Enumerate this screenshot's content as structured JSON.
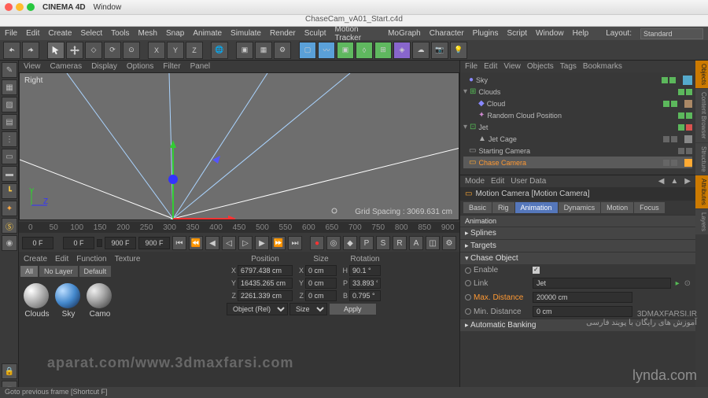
{
  "title": {
    "app": "CINEMA 4D",
    "menu": "Window",
    "doc": "ChaseCam_vA01_Start.c4d"
  },
  "menubar": [
    "File",
    "Edit",
    "Create",
    "Select",
    "Tools",
    "Mesh",
    "Snap",
    "Animate",
    "Simulate",
    "Render",
    "Sculpt",
    "Motion Tracker",
    "MoGraph",
    "Character",
    "Plugins",
    "Script",
    "Window",
    "Help"
  ],
  "layout_label": "Layout:",
  "layout_value": "Standard",
  "axis_letters": [
    "X",
    "Y",
    "Z"
  ],
  "viewmenu": [
    "View",
    "Cameras",
    "Display",
    "Options",
    "Filter",
    "Panel"
  ],
  "viewport": {
    "label": "Right",
    "grid_label": "Grid Spacing :",
    "grid_value": "3069.631 cm"
  },
  "timeline_marks": [
    "0",
    "50",
    "100",
    "150",
    "200",
    "250",
    "300",
    "350",
    "400",
    "450",
    "500",
    "550",
    "600",
    "650",
    "700",
    "750",
    "800",
    "850",
    "900"
  ],
  "transport": {
    "cur": "0 F",
    "start": "0 F",
    "end": "900 F",
    "end2": "900 F"
  },
  "materials": {
    "menu": [
      "Create",
      "Edit",
      "Function",
      "Texture"
    ],
    "tabs": [
      "All",
      "No Layer",
      "Default"
    ],
    "items": [
      "Clouds",
      "Sky",
      "Camo"
    ]
  },
  "coords": {
    "headers": [
      "Position",
      "Size",
      "Rotation"
    ],
    "rows": [
      {
        "axis": "X",
        "pos": "6797.438 cm",
        "size": "0 cm",
        "rot": "90.1 °",
        "rotlab": "H"
      },
      {
        "axis": "Y",
        "pos": "16435.265 cm",
        "size": "0 cm",
        "rot": "33.893 °",
        "rotlab": "P"
      },
      {
        "axis": "Z",
        "pos": "2261.339 cm",
        "size": "0 cm",
        "rot": "0.795 °",
        "rotlab": "B"
      }
    ],
    "obj_mode": "Object (Rel)",
    "size_mode": "Size",
    "apply": "Apply"
  },
  "obj": {
    "menu": [
      "File",
      "Edit",
      "View",
      "Objects",
      "Tags",
      "Bookmarks"
    ],
    "tree": [
      {
        "name": "Sky",
        "depth": 0,
        "cls": ""
      },
      {
        "name": "Clouds",
        "depth": 0,
        "cls": "",
        "exp": true
      },
      {
        "name": "Cloud",
        "depth": 1,
        "cls": ""
      },
      {
        "name": "Random Cloud Position",
        "depth": 1,
        "cls": ""
      },
      {
        "name": "Jet",
        "depth": 0,
        "cls": "",
        "exp": true
      },
      {
        "name": "Jet Cage",
        "depth": 1,
        "cls": ""
      },
      {
        "name": "Starting Camera",
        "depth": 0,
        "cls": ""
      },
      {
        "name": "Chase Camera",
        "depth": 0,
        "cls": "orange",
        "sel": true
      }
    ]
  },
  "attr": {
    "menu": [
      "Mode",
      "Edit",
      "User Data"
    ],
    "title": "Motion Camera [Motion Camera]",
    "tabs": [
      "Basic",
      "Rig",
      "Animation",
      "Dynamics",
      "Motion",
      "Focus"
    ],
    "active_tab": "Animation",
    "sections": {
      "anim": "Animation",
      "splines": "Splines",
      "targets": "Targets",
      "chase": "Chase Object",
      "auto": "Automatic Banking"
    },
    "chase": {
      "enable_label": "Enable",
      "enable": true,
      "link_label": "Link",
      "link": "Jet",
      "max_label": "Max. Distance",
      "max": "20000 cm",
      "min_label": "Min. Distance",
      "min": "0 cm"
    }
  },
  "right_tabs": [
    "Objects",
    "Content Browser",
    "Structure",
    "Attributes",
    "Layers"
  ],
  "status": "Goto previous frame [Shortcut F]",
  "watermark": "aparat.com/www.3dmaxfarsi.com",
  "lynda": "lynda.com",
  "farsi_top": "3DMAXFARSI.IR",
  "farsi_sub": "آموزش های رایگان با پویند فارسی"
}
